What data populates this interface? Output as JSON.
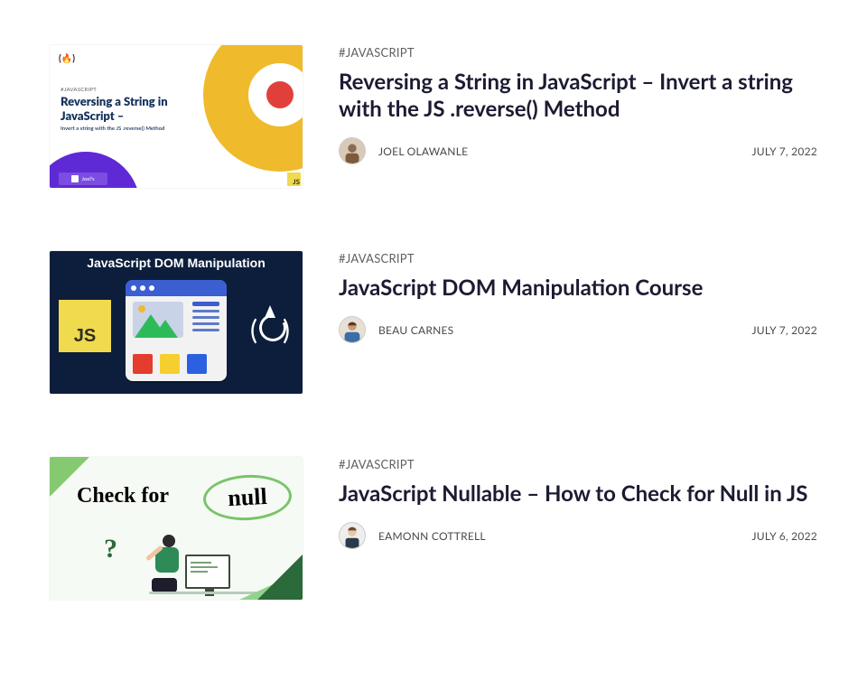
{
  "articles": [
    {
      "tag": "#JAVASCRIPT",
      "title": "Reversing a String in JavaScript – Invert a string with the JS .reverse() Method",
      "author": "JOEL OLAWANLE",
      "date": "JULY 7, 2022",
      "thumb": {
        "brand": "(🔥)",
        "small_tag": "#JAVASCRIPT",
        "headline": "Reversing a String in JavaScript –",
        "sub": "Invert a string with the JS .reverse() Method",
        "author_badge": "Joel's",
        "js_badge": "JS"
      }
    },
    {
      "tag": "#JAVASCRIPT",
      "title": "JavaScript DOM Manipulation Course",
      "author": "BEAU CARNES",
      "date": "JULY 7, 2022",
      "thumb": {
        "caption": "JavaScript DOM Manipulation",
        "js_logo": "JS",
        "fire_left": "(",
        "fire_right": ")"
      }
    },
    {
      "tag": "#JAVASCRIPT",
      "title": "JavaScript Nullable – How to Check for Null in JS",
      "author": "EAMONN COTTRELL",
      "date": "JULY 6, 2022",
      "thumb": {
        "text_check": "Check for",
        "null_text": "null",
        "qmark": "?"
      }
    }
  ]
}
